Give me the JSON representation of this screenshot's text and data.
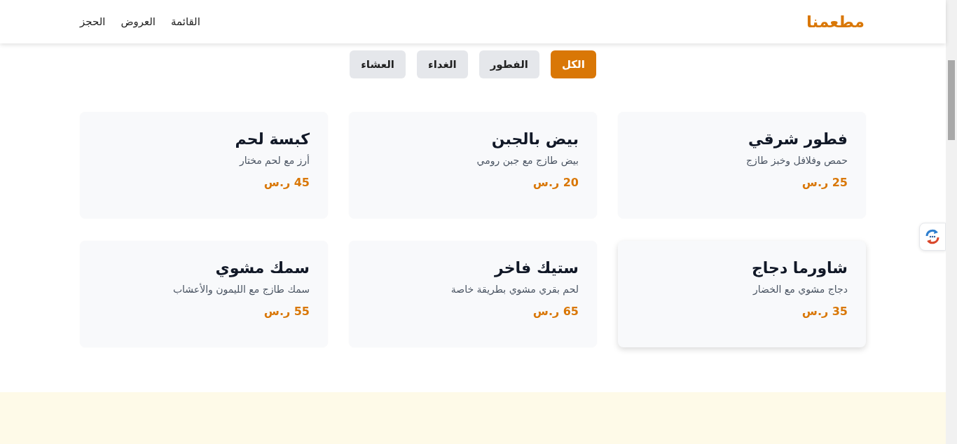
{
  "header": {
    "logo": "مطعمنا",
    "nav": [
      "القائمة",
      "العروض",
      "الحجز"
    ]
  },
  "filters": [
    {
      "label": "الكل",
      "selected": true
    },
    {
      "label": "الفطور",
      "selected": false
    },
    {
      "label": "الغداء",
      "selected": false
    },
    {
      "label": "العشاء",
      "selected": false
    }
  ],
  "dishes": [
    {
      "name": "فطور شرقي",
      "description": "حمص وفلافل وخبز طازج",
      "price": "25 ر.س",
      "raised": false
    },
    {
      "name": "بيض بالجبن",
      "description": "بيض طازج مع جبن رومي",
      "price": "20 ر.س",
      "raised": false
    },
    {
      "name": "كبسة لحم",
      "description": "أرز مع لحم مختار",
      "price": "45 ر.س",
      "raised": false
    },
    {
      "name": "شاورما دجاج",
      "description": "دجاج مشوي مع الخضار",
      "price": "35 ر.س",
      "raised": true
    },
    {
      "name": "ستيك فاخر",
      "description": "لحم بقري مشوي بطريقة خاصة",
      "price": "65 ر.س",
      "raised": false
    },
    {
      "name": "سمك مشوي",
      "description": "سمك طازج مع الليمون والأعشاب",
      "price": "55 ر.س",
      "raised": false
    }
  ]
}
